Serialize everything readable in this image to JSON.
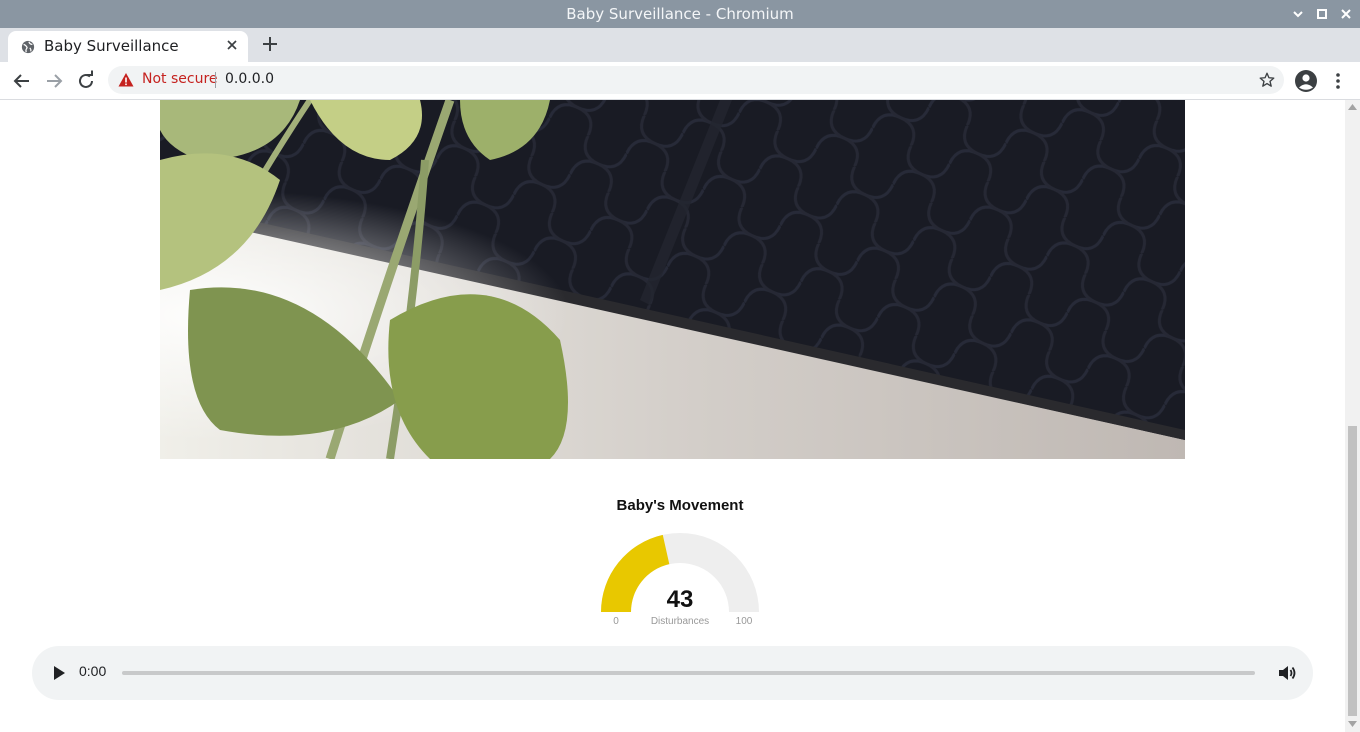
{
  "window": {
    "title": "Baby Surveillance - Chromium"
  },
  "tab": {
    "title": "Baby Surveillance"
  },
  "address_bar": {
    "security_label": "Not secure",
    "url": "0.0.0.0"
  },
  "page": {
    "gauge": {
      "title": "Baby's Movement",
      "value": "43",
      "min": "0",
      "max": "100",
      "label": "Disturbances",
      "fraction": 0.43,
      "fill_color": "#e8c800",
      "track_color": "#eeeeee"
    },
    "audio": {
      "time": "0:00",
      "progress": 0
    }
  },
  "colors": {
    "titlebar": "#8a96a2",
    "tabstrip": "#dee1e6",
    "warning": "#c5221f"
  },
  "icons": [
    "minimize-icon",
    "maximize-icon",
    "close-icon",
    "globe-icon",
    "plus-icon",
    "back-arrow-icon",
    "forward-arrow-icon",
    "reload-icon",
    "warning-icon",
    "star-icon",
    "profile-icon",
    "kebab-menu-icon",
    "play-icon",
    "volume-icon"
  ]
}
